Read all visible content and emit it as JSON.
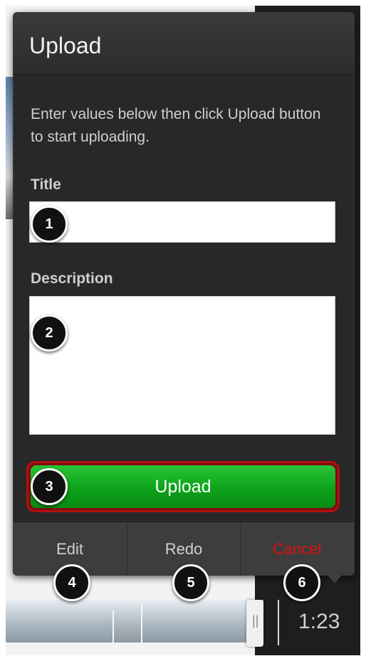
{
  "dialog": {
    "title": "Upload",
    "instructions": "Enter values below then click Upload button to start uploading.",
    "title_label": "Title",
    "title_value": "",
    "description_label": "Description",
    "description_value": "",
    "upload_button": "Upload"
  },
  "toolbar": {
    "edit": "Edit",
    "redo": "Redo",
    "cancel": "Cancel"
  },
  "media": {
    "time": "1:23",
    "handle_grip": "||"
  },
  "callouts": [
    "1",
    "2",
    "3",
    "4",
    "5",
    "6"
  ],
  "colors": {
    "upload_green": "#12a81f",
    "cancel_red": "#e01010",
    "highlight_border": "#b01111"
  }
}
